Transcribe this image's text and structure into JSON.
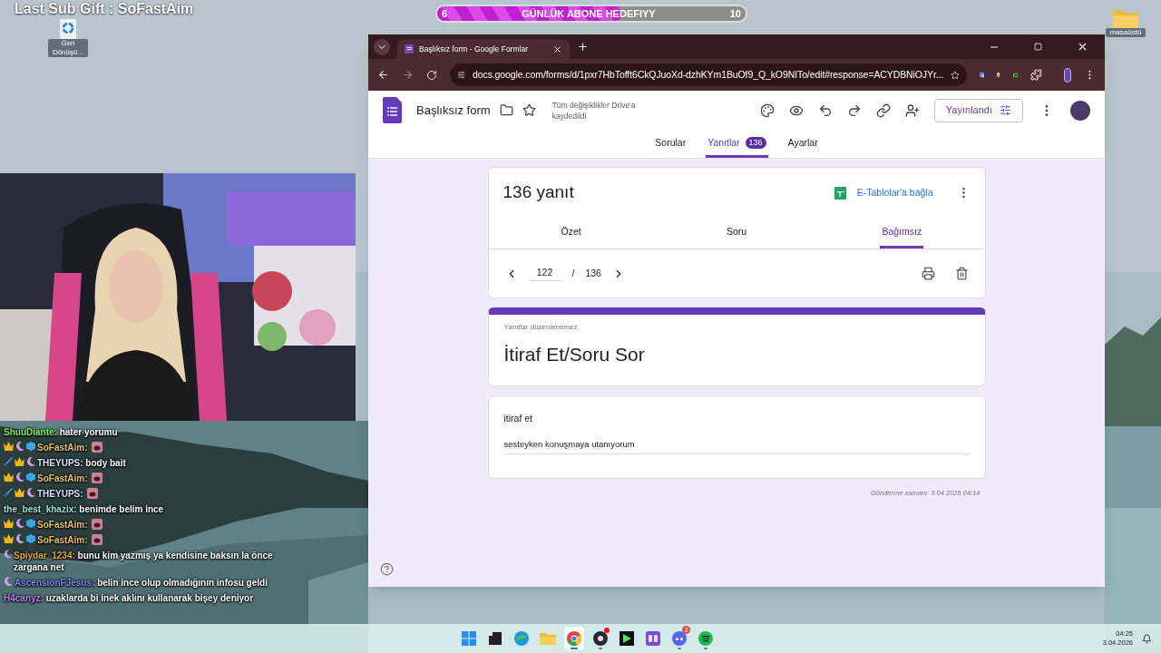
{
  "overlay": {
    "title": "Last Sub Gift : SoFastAim"
  },
  "goal": {
    "start": "6",
    "label": "GÜNLÜK ABONE HEDEFIYY",
    "end": "10",
    "level": 0.6
  },
  "desktop_icons": [
    {
      "kind": "recycle",
      "label": "Geri Dönüşü..."
    },
    {
      "kind": "folder",
      "label": "masaüstü"
    }
  ],
  "chat": [
    {
      "user": "ShuuDiante:",
      "color": "#7cf25a",
      "text": "hater yorumu",
      "emote": false
    },
    {
      "user": "SoFastAim:",
      "color": "#e8c070",
      "badges": [
        {
          "kind": "crown"
        },
        {
          "kind": "moon"
        },
        {
          "kind": "cube"
        }
      ],
      "emote": true
    },
    {
      "user": "THEYUPS:",
      "color": "#d8e2ff",
      "badges": [
        {
          "kind": "sword"
        },
        {
          "kind": "crown"
        },
        {
          "kind": "moon"
        }
      ],
      "text": "body bait",
      "emote": false
    },
    {
      "user": "SoFastAim:",
      "color": "#e8c070",
      "badges": [
        {
          "kind": "crown"
        },
        {
          "kind": "moon"
        },
        {
          "kind": "cube"
        }
      ],
      "emote": true
    },
    {
      "user": "THEYUPS:",
      "color": "#d8e2ff",
      "badges": [
        {
          "kind": "sword"
        },
        {
          "kind": "crown"
        },
        {
          "kind": "moon"
        }
      ],
      "emote": true
    },
    {
      "user": "the_best_khazix:",
      "color": "#9ee6d8",
      "text": "benimde belim ince",
      "emote": false
    },
    {
      "user": "SoFastAim:",
      "color": "#e8c070",
      "badges": [
        {
          "kind": "crown"
        },
        {
          "kind": "moon"
        },
        {
          "kind": "cube"
        }
      ],
      "emote": true
    },
    {
      "user": "SoFastAim:",
      "color": "#e8c070",
      "badges": [
        {
          "kind": "crown"
        },
        {
          "kind": "moon"
        },
        {
          "kind": "cube"
        }
      ],
      "emote": true
    },
    {
      "user": "Spiydar_1234:",
      "color": "#e0a848",
      "badges": [
        {
          "kind": "moon"
        }
      ],
      "text": "bunu kim yazmış ya kendisine baksın la önce zargana net",
      "emote": false
    },
    {
      "user": "AscensionFJesus:",
      "color": "#7f8cf4",
      "badges": [
        {
          "kind": "moon"
        }
      ],
      "text": "belin ince olup olmadığının infosu geldi",
      "emote": false
    },
    {
      "user": "H4canyz:",
      "color": "#bb82ec",
      "text": "uzaklarda bi inek aklını kullanarak bişey deniyor",
      "emote": false
    }
  ],
  "browser": {
    "tab_title": "Başlıksız form - Google Formlar",
    "url": "docs.google.com/forms/d/1pxr7HbTofft6CkQJuoXd-dzhKYm1BuOf9_Q_kO9NITo/edit#response=ACYDBNiOJYr..."
  },
  "form_header": {
    "title": "Başlıksız form",
    "save_status": "Tüm değişiklikler Drive'a kaydedildi",
    "publish_button": "Yayınlandı"
  },
  "tabs": [
    {
      "label": "Sorular",
      "selected": false
    },
    {
      "label": "Yanıtlar",
      "selected": true,
      "count": "136"
    },
    {
      "label": "Ayarlar",
      "selected": false
    }
  ],
  "responses": {
    "title": "136 yanıt",
    "link_sheets": "E-Tablolar'a bağla",
    "subtabs": [
      {
        "label": "Özet",
        "selected": false
      },
      {
        "label": "Soru",
        "selected": false
      },
      {
        "label": "Bağımsız",
        "selected": true
      }
    ],
    "current": "122",
    "separator": "/",
    "total": "136"
  },
  "form_card": {
    "note": "Yanıtlar düzenlenemez",
    "title": "İtiraf Et/Soru Sor"
  },
  "question": {
    "label": "itiraf et",
    "answer": "sesteyken konuşmaya utanıyorum"
  },
  "submitted": "Gönderme zamanı: 3.04.2026 04:14",
  "taskbar": {
    "apps": [
      {
        "kind": "start",
        "selected": false,
        "running": false,
        "dot": false
      },
      {
        "kind": "terminal",
        "selected": false,
        "running": false,
        "dot": false
      },
      {
        "kind": "edge",
        "selected": false,
        "running": false,
        "dot": false
      },
      {
        "kind": "folder",
        "selected": false,
        "running": false,
        "dot": false
      },
      {
        "kind": "chrome",
        "selected": true,
        "running": true,
        "dot": false
      },
      {
        "kind": "obs",
        "selected": false,
        "running": true,
        "dot": true
      },
      {
        "kind": "media",
        "selected": false,
        "running": false,
        "dot": false
      },
      {
        "kind": "mirror",
        "selected": false,
        "running": false,
        "dot": false
      },
      {
        "kind": "discord",
        "selected": false,
        "running": true,
        "dot": false,
        "badge": "2"
      },
      {
        "kind": "spotify",
        "selected": false,
        "running": true,
        "dot": false
      }
    ],
    "time": "04:25",
    "date": "3.04.2026"
  }
}
